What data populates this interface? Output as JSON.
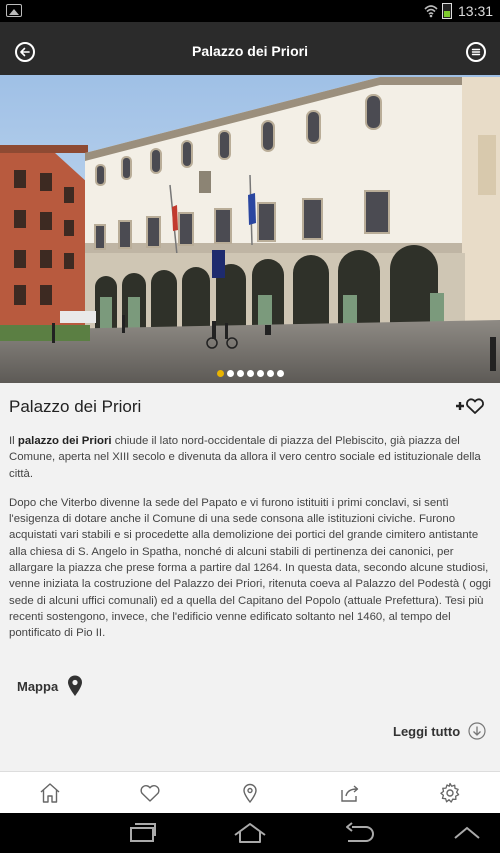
{
  "statusbar": {
    "time": "13:31"
  },
  "appbar": {
    "title": "Palazzo dei Priori"
  },
  "gallery": {
    "total": 7,
    "active": 1
  },
  "content": {
    "heading": "Palazzo dei Priori",
    "paragraph1": {
      "prefix": "Il ",
      "bold": "palazzo dei Priori",
      "rest": " chiude il lato nord-occidentale di piazza del Plebiscito, già piazza del Comune, aperta nel XIII secolo e divenuta da allora il vero centro sociale ed istituzionale della città."
    },
    "paragraph2": "Dopo che Viterbo divenne la sede del Papato e vi furono istituiti i primi conclavi, si sentì l'esigenza di dotare anche il Comune di una sede consona alle istituzioni civiche. Furono acquistati vari stabili e si procedette alla demolizione dei portici del grande cimitero antistante alla chiesa di S. Angelo in Spatha, nonché di alcuni stabili di pertinenza dei canonici, per allargare la piazza che prese forma a partire dal 1264. In questa data, secondo alcune studiosi, venne iniziata la costruzione del Palazzo dei Priori, ritenuta coeva al Palazzo del Podestà ( oggi sede di alcuni uffici comunali) ed a quella del Capitano del Popolo (attuale Prefettura). Tesi più recenti sostengono, invece, che l'edificio venne edificato soltanto nel 1460, al tempo del pontificato di Pio II.",
    "map_label": "Mappa",
    "read_all_label": "Leggi tutto"
  },
  "tabs": [
    "home-icon",
    "heart-icon",
    "location-pin-icon",
    "share-icon",
    "gear-icon"
  ]
}
